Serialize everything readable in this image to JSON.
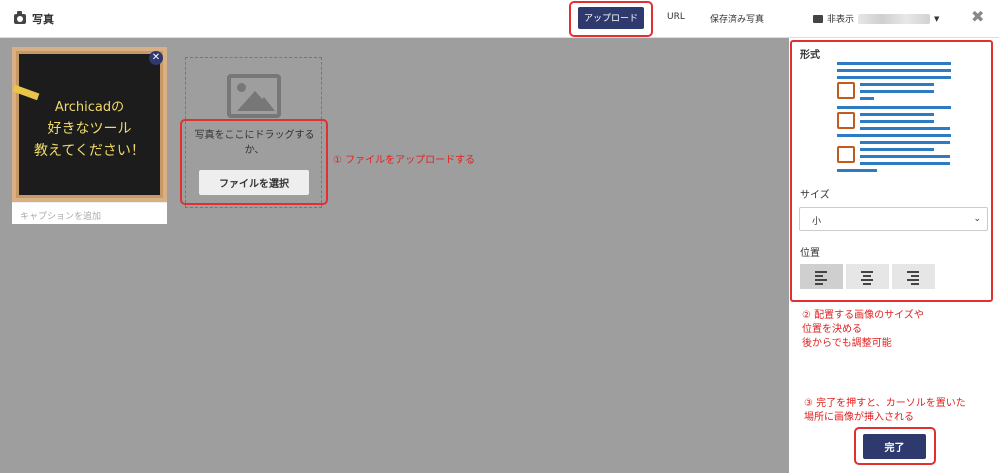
{
  "header": {
    "title": "写真",
    "tabs": {
      "upload": "アップロード",
      "url": "URL",
      "saved": "保存済み写真"
    },
    "dropdown_label": "非表示"
  },
  "image_card": {
    "chalk_lines": [
      "Archicadの",
      "好きなツール",
      "教えてください！"
    ],
    "caption_placeholder": "キャプションを追加"
  },
  "dropzone": {
    "text": "写真をここにドラッグするか、",
    "button": "ファイルを選択"
  },
  "annotations": {
    "a1": "① ファイルをアップロードする",
    "a2_lines": [
      "② 配置する画像のサイズや",
      "位置を決める",
      "後からでも調整可能"
    ],
    "a3_lines": [
      "③ 完了を押すと、カーソルを置いた",
      "場所に画像が挿入される"
    ]
  },
  "panel": {
    "format_label": "形式",
    "size_label": "サイズ",
    "size_value": "小",
    "position_label": "位置",
    "done": "完了"
  },
  "colors": {
    "primary": "#2e3a6e",
    "annotation": "#e03030",
    "overlay": "#9e9e9e"
  }
}
